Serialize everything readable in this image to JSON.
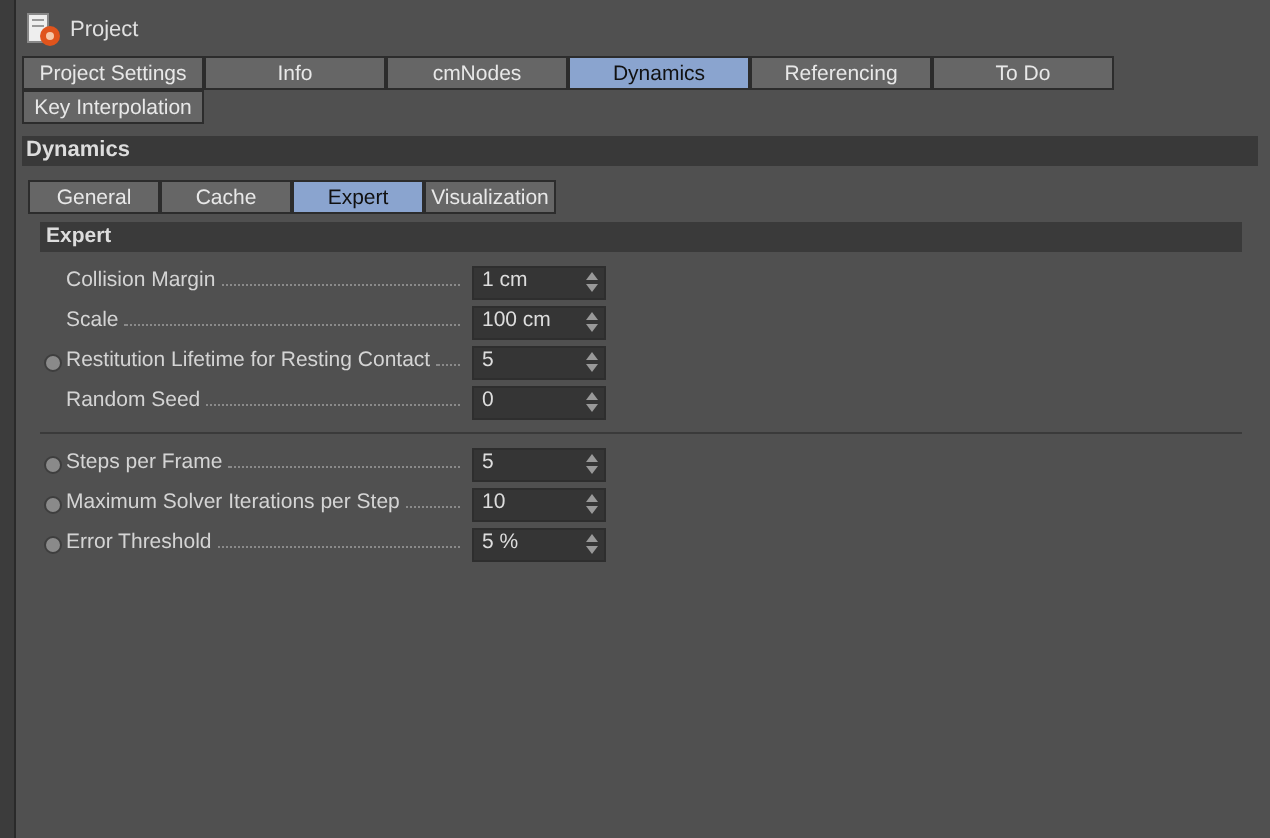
{
  "window": {
    "title": "Project"
  },
  "tabs": [
    {
      "label": "Project Settings",
      "selected": false
    },
    {
      "label": "Info",
      "selected": false
    },
    {
      "label": "cmNodes",
      "selected": false
    },
    {
      "label": "Dynamics",
      "selected": true
    },
    {
      "label": "Referencing",
      "selected": false
    },
    {
      "label": "To Do",
      "selected": false
    },
    {
      "label": "Key Interpolation",
      "selected": false
    }
  ],
  "section": {
    "title": "Dynamics"
  },
  "subtabs": [
    {
      "label": "General",
      "selected": false
    },
    {
      "label": "Cache",
      "selected": false
    },
    {
      "label": "Expert",
      "selected": true
    },
    {
      "label": "Visualization",
      "selected": false
    }
  ],
  "group": {
    "title": "Expert"
  },
  "field_groups": [
    [
      {
        "label": "Collision Margin",
        "value": "1 cm",
        "animatable": false
      },
      {
        "label": "Scale",
        "value": "100 cm",
        "animatable": false
      },
      {
        "label": "Restitution Lifetime for Resting Contact",
        "value": "5",
        "animatable": true
      },
      {
        "label": "Random Seed",
        "value": "0",
        "animatable": false
      }
    ],
    [
      {
        "label": "Steps per Frame",
        "value": "5",
        "animatable": true
      },
      {
        "label": "Maximum Solver Iterations per Step",
        "value": "10",
        "animatable": true
      },
      {
        "label": "Error Threshold",
        "value": "5 %",
        "animatable": true
      }
    ]
  ]
}
